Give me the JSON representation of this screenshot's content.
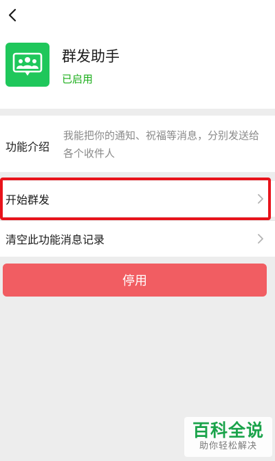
{
  "header": {
    "back_icon": "chevron-left-icon"
  },
  "app": {
    "name": "群发助手",
    "status": "已启用",
    "icon": "group-chat-icon",
    "icon_color": "#1fc75b",
    "status_color": "#1aad19"
  },
  "intro": {
    "label": "功能介绍",
    "text": "我能把你的通知、祝福等消息，分别发送给各个收件人"
  },
  "menu": {
    "items": [
      {
        "label": "开始群发",
        "icon": "chevron-right-icon",
        "highlighted": true
      },
      {
        "label": "清空此功能消息记录",
        "icon": "chevron-right-icon",
        "highlighted": false
      }
    ]
  },
  "actions": {
    "disable_label": "停用",
    "disable_color": "#f15d62"
  },
  "watermark": {
    "title": "百科全说",
    "subtitle": "助你轻松解决"
  },
  "colors": {
    "highlight": "#e8131b",
    "background": "#ededed"
  }
}
